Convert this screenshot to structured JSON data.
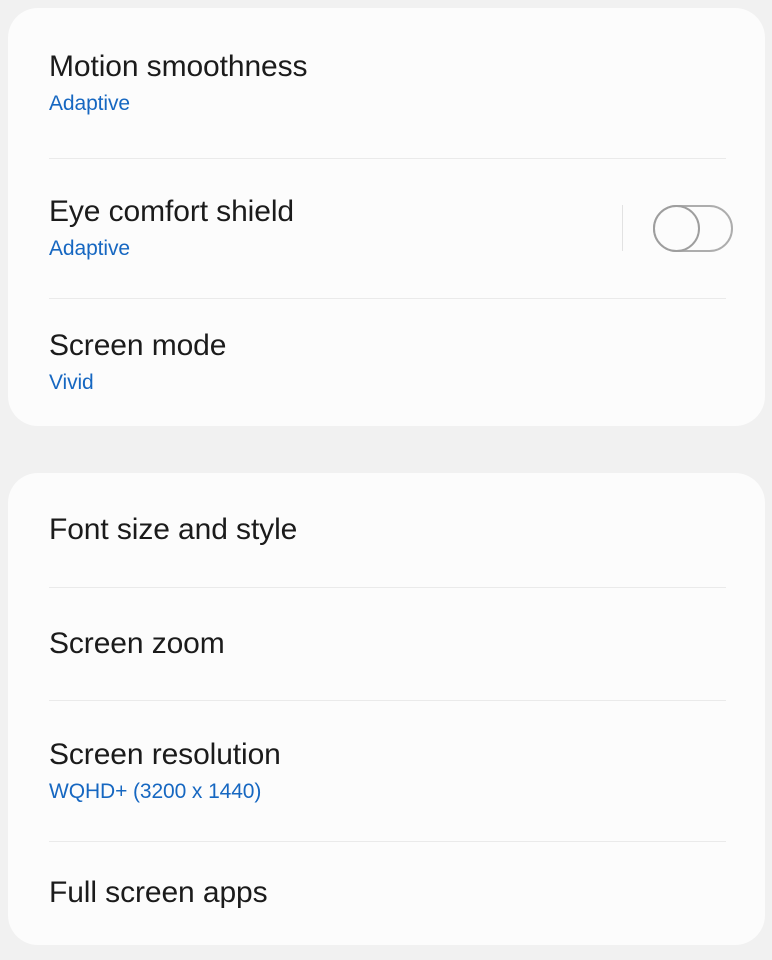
{
  "screen": {
    "name": "display-settings",
    "background_color": "#f1f1f1",
    "card_color": "#fcfcfc",
    "accent_color": "#1667c1",
    "title_color": "#1b1b1b",
    "divider_color": "#eaeaea"
  },
  "groups": [
    {
      "id": "display-quality",
      "items": [
        {
          "id": "motion-smoothness",
          "title": "Motion smoothness",
          "value": "Adaptive",
          "control": "none"
        },
        {
          "id": "eye-comfort-shield",
          "title": "Eye comfort shield",
          "value": "Adaptive",
          "control": "toggle",
          "toggle_state": "off"
        },
        {
          "id": "screen-mode",
          "title": "Screen mode",
          "value": "Vivid",
          "control": "none"
        }
      ]
    },
    {
      "id": "display-layout",
      "items": [
        {
          "id": "font-size-and-style",
          "title": "Font size and style",
          "value": "",
          "control": "none"
        },
        {
          "id": "screen-zoom",
          "title": "Screen zoom",
          "value": "",
          "control": "none"
        },
        {
          "id": "screen-resolution",
          "title": "Screen resolution",
          "value": "WQHD+ (3200 x 1440)",
          "control": "none"
        },
        {
          "id": "full-screen-apps",
          "title": "Full screen apps",
          "value": "",
          "control": "none"
        }
      ]
    }
  ]
}
